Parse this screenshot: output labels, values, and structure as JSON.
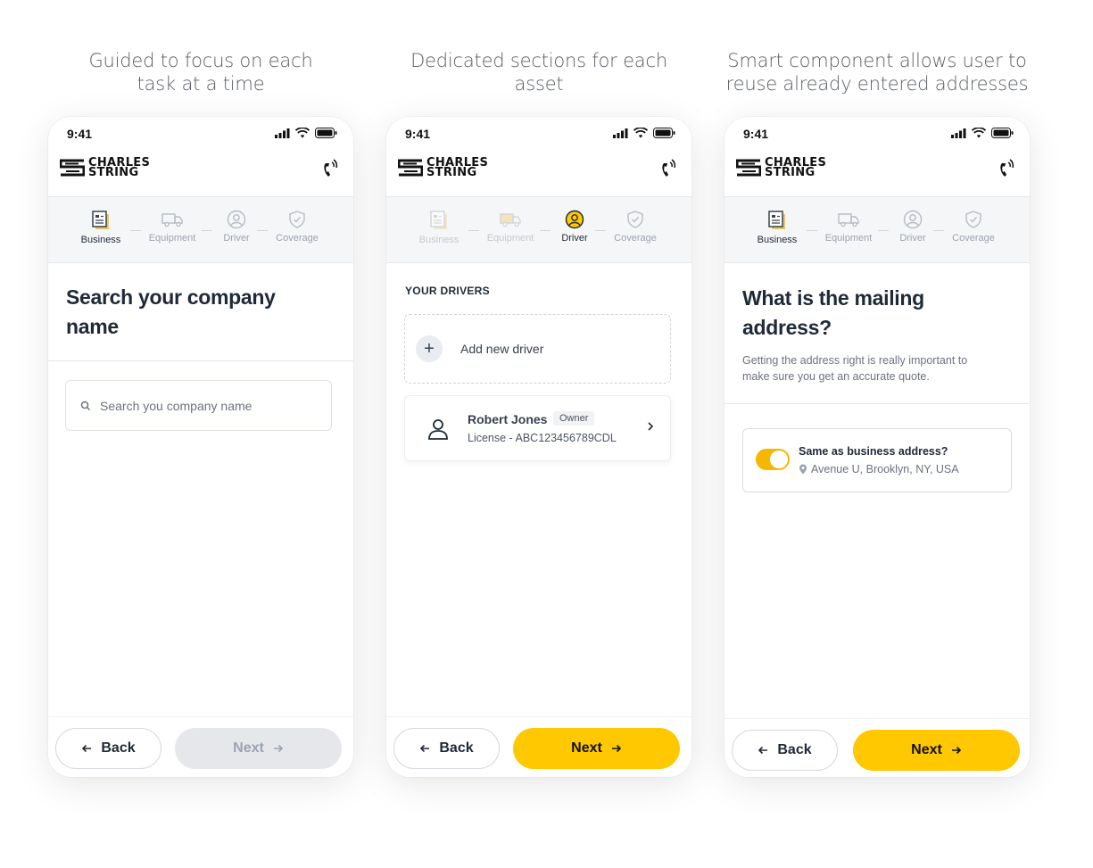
{
  "colors": {
    "accent": "#ffc800",
    "toggle_on": "#f5b800",
    "disabled": "#e5e7eb"
  },
  "icons": {
    "signal": "signal-icon",
    "wifi": "wifi-icon",
    "battery": "battery-icon",
    "phone": "phone-call-icon",
    "back": "arrow-left-icon",
    "next": "arrow-right-icon"
  },
  "brand": {
    "line1": "CHARLES",
    "line2": "STRING"
  },
  "steps": [
    "Business",
    "Equipment",
    "Driver",
    "Coverage"
  ],
  "screens": [
    {
      "caption_line1": "Guided to focus on each",
      "caption_line2": "task at a time",
      "time": "9:41",
      "active_step": "Business",
      "title_line1": "Search your company",
      "title_line2": "name",
      "search_placeholder": "Search you company name",
      "back": "Back",
      "next": "Next",
      "next_enabled": false
    },
    {
      "caption_line1": "Dedicated sections for each",
      "caption_line2": "asset",
      "time": "9:41",
      "active_step": "Driver",
      "section_label": "YOUR DRIVERS",
      "add_driver": "Add new driver",
      "driver": {
        "name": "Robert Jones",
        "badge": "Owner",
        "license": "License - ABC123456789CDL"
      },
      "back": "Back",
      "next": "Next",
      "next_enabled": true
    },
    {
      "caption_line1": "Smart component allows user to",
      "caption_line2": "reuse already entered addresses",
      "time": "9:41",
      "active_step": "Business",
      "title_line1": "What is the mailing",
      "title_line2": "address?",
      "subtitle_line1": "Getting the address right is really important to",
      "subtitle_line2": "make sure you get an accurate quote.",
      "toggle_label": "Same as business address?",
      "toggle_on": true,
      "address": "Avenue U, Brooklyn, NY, USA",
      "back": "Back",
      "next": "Next",
      "next_enabled": true
    }
  ]
}
